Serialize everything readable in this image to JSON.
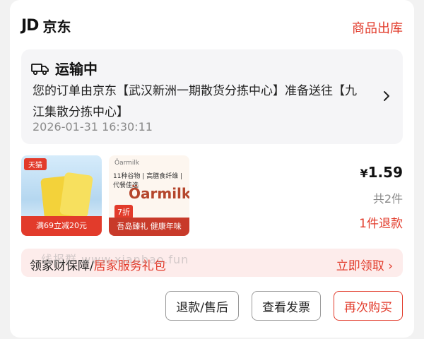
{
  "header": {
    "logo_text": "JD",
    "store_name": "京东",
    "status": "商品出库"
  },
  "shipping": {
    "title": "运输中",
    "description": "您的订单由京东【武汉新洲一期散货分拣中心】准备送往【九江集散分拣中心】",
    "time": "2026-01-31 16:30:11",
    "icon": "truck-icon"
  },
  "products": [
    {
      "tag": "天猫",
      "promo": "满69立减20元",
      "logo_text": "",
      "tagline": "",
      "highlight": "",
      "badge": "",
      "bottom": ""
    },
    {
      "tag": "",
      "promo": "",
      "logo_text": "Öarmilk",
      "tagline": "11种谷物 | 高膳食纤维 | 代餐佳选",
      "highlight": "7折",
      "badge": "",
      "bottom": "吾岛臻礼 健康年味"
    }
  ],
  "summary": {
    "currency": "¥",
    "price": "1.59",
    "quantity": "共2件",
    "refund": "1件退款"
  },
  "warranty": {
    "prefix": "领家财保障/",
    "highlight": "居家服务礼包",
    "action": "立即领取",
    "watermark": "线报群 www.xianbao.fun"
  },
  "actions": {
    "refund_label": "退款/售后",
    "invoice_label": "查看发票",
    "rebuy_label": "再次购买"
  },
  "colors": {
    "accent": "#e23b2b",
    "muted": "#8a8a8a",
    "panel": "#f5f5f7"
  }
}
